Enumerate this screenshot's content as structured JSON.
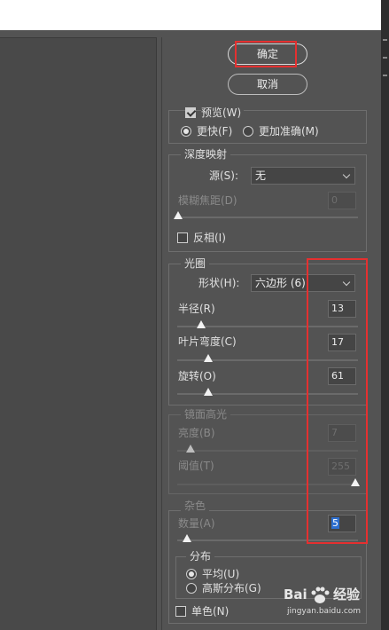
{
  "buttons": {
    "ok": "确定",
    "cancel": "取消"
  },
  "preview": {
    "checkbox_label": "预览(W)",
    "checked": true,
    "radio_faster": "更快(F)",
    "radio_accurate": "更加准确(M)",
    "selected": "faster"
  },
  "depth_map": {
    "title": "深度映射",
    "source_label": "源(S):",
    "source_value": "无",
    "blur_focal_label": "模糊焦距(D)",
    "blur_focal_value": "0",
    "invert_label": "反相(I)",
    "invert_checked": false
  },
  "iris": {
    "title": "光圈",
    "shape_label": "形状(H):",
    "shape_value": "六边形 (6)",
    "radius_label": "半径(R)",
    "radius_value": "13",
    "blade_label": "叶片弯度(C)",
    "blade_value": "17",
    "rotation_label": "旋转(O)",
    "rotation_value": "61"
  },
  "specular": {
    "title": "镜面高光",
    "brightness_label": "亮度(B)",
    "brightness_value": "7",
    "threshold_label": "阈值(T)",
    "threshold_value": "255"
  },
  "noise": {
    "title": "杂色",
    "amount_label": "数量(A)",
    "amount_value": "5",
    "distribution_title": "分布",
    "uniform_label": "平均(U)",
    "gaussian_label": "高斯分布(G)",
    "selected": "uniform",
    "mono_label": "单色(N)",
    "mono_checked": false
  },
  "watermark": {
    "brand": "Bai",
    "brand2": "经验",
    "url": "jingyan.baidu.com"
  },
  "colors": {
    "background": "#535353",
    "highlight": "#e53030",
    "selection": "#2d6fd0"
  }
}
